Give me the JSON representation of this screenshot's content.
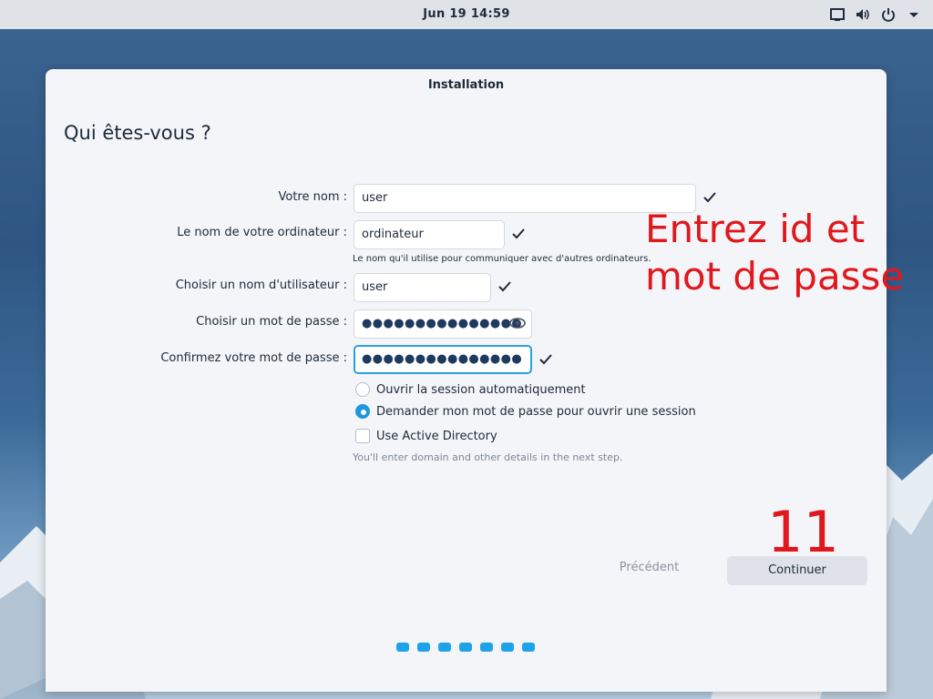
{
  "topbar": {
    "clock": "Jun 19  14:59",
    "icons": [
      "screen-icon",
      "volume-icon",
      "power-icon",
      "chevron-down-icon"
    ]
  },
  "window": {
    "title": "Installation",
    "heading": "Qui êtes-vous ?"
  },
  "form": {
    "name_label": "Votre nom :",
    "name_value": "user",
    "computer_label": "Le nom de votre ordinateur :",
    "computer_value": "ordinateur",
    "computer_hint": "Le nom qu'il utilise pour communiquer avec d'autres ordinateurs.",
    "username_label": "Choisir un nom d'utilisateur :",
    "username_value": "user",
    "password_label": "Choisir un mot de passe :",
    "password_value": "●●●●●●●●●●●●●●●",
    "confirm_label": "Confirmez votre mot de passe :",
    "confirm_value": "●●●●●●●●●●●●●●●",
    "autologin_label": "Ouvrir la session automatiquement",
    "ask_password_label": "Demander mon mot de passe pour ouvrir une session",
    "ad_label": "Use Active Directory",
    "ad_hint": "You'll enter domain and other details in the next step."
  },
  "buttons": {
    "previous": "Précédent",
    "continue": "Continuer"
  },
  "pager": {
    "steps": 7
  },
  "annotations": {
    "instruction_line1": "Entrez id et",
    "instruction_line2": "mot de passe",
    "step_number": "11"
  },
  "colors": {
    "accent": "#1ea3e8",
    "annotation": "#e0181c"
  }
}
